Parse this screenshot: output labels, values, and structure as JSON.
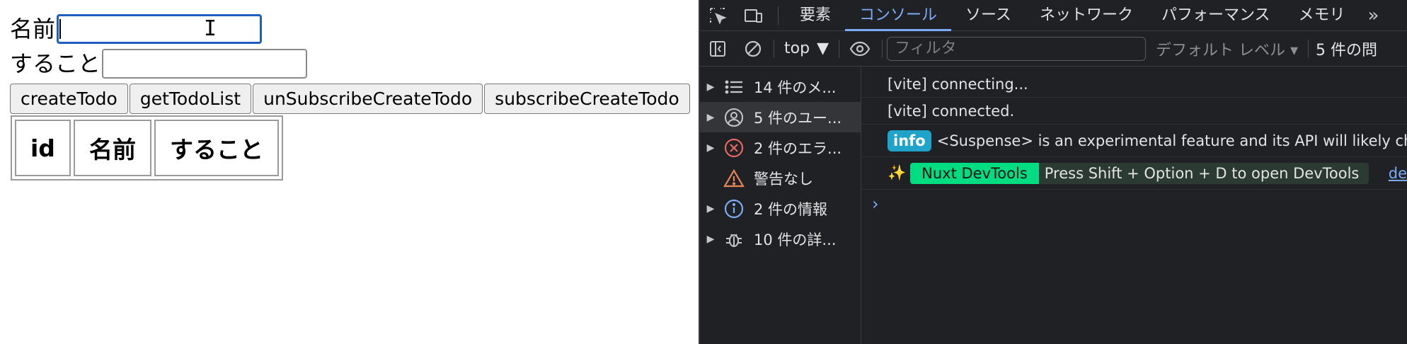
{
  "form": {
    "name_label": "名前",
    "name_value": "",
    "todo_label": "すること",
    "todo_value": ""
  },
  "buttons": {
    "create": "createTodo",
    "get_list": "getTodoList",
    "unsubscribe": "unSubscribeCreateTodo",
    "subscribe": "subscribeCreateTodo"
  },
  "table": {
    "headers": [
      "id",
      "名前",
      "すること"
    ]
  },
  "devtools": {
    "tabs": [
      "要素",
      "コンソール",
      "ソース",
      "ネットワーク",
      "パフォーマンス",
      "メモリ"
    ],
    "active_tab": "コンソール",
    "more": "»",
    "context": "top",
    "filter_placeholder": "フィルタ",
    "levels": "デフォルト レベル ▾",
    "issues": "5 件の問",
    "sidebar": [
      {
        "label": "14 件のメ...",
        "icon": "list-icon",
        "expandable": true
      },
      {
        "label": "5 件のユー...",
        "icon": "user-icon",
        "expandable": true
      },
      {
        "label": "2 件のエラ...",
        "icon": "error-icon",
        "expandable": true
      },
      {
        "label": "警告なし",
        "icon": "warning-icon",
        "expandable": false
      },
      {
        "label": "2 件の情報",
        "icon": "info-icon",
        "expandable": true
      },
      {
        "label": "10 件の詳...",
        "icon": "bug-icon",
        "expandable": true
      }
    ],
    "logs": {
      "line1": "[vite] connecting...",
      "line2": "[vite] connected.",
      "info_badge": "info",
      "line3": "<Suspense> is an experimental feature and its API will likely change.",
      "sparkle": "✨",
      "nuxt_badge": "Nuxt DevTools",
      "nuxt_msg": "Press Shift + Option + D to open DevTools",
      "src_link": "de"
    },
    "prompt": "›"
  },
  "colors": {
    "accent": "#7cacf8",
    "focus": "#1f5fbf",
    "info": "#1fa3c8",
    "nuxt": "#00dc82",
    "error": "#e46962",
    "warning": "#e8865a"
  }
}
